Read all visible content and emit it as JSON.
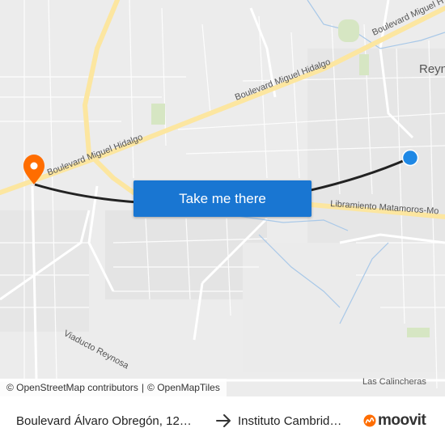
{
  "map": {
    "labels": {
      "blvd_hidalgo_1": "Boulevard Miguel Hidalgo",
      "blvd_hidalgo_2": "Boulevard Miguel Hidalgo",
      "blvd_hidalgo_3": "Boulevard Miguel H",
      "libramiento": "Libramiento Matamoros-Mo",
      "viaducto": "Viaducto Reynosa",
      "calincheras": "Las Calincheras",
      "city": "Reyn"
    },
    "colors": {
      "road_major": "#fce6a0",
      "route_line": "#222222",
      "origin_marker": "#1e88e5",
      "destination_marker": "#ff6d00",
      "park": "#d6e6c3",
      "water": "#a8c8e8"
    },
    "attribution": {
      "osm": "© OpenStreetMap contributors",
      "separator": "|",
      "omt": "© OpenMapTiles"
    }
  },
  "cta": {
    "label": "Take me there"
  },
  "footer": {
    "origin": "Boulevard Álvaro Obregón, 12…",
    "destination": "Instituto Cambrid…",
    "brand": "moovit"
  }
}
